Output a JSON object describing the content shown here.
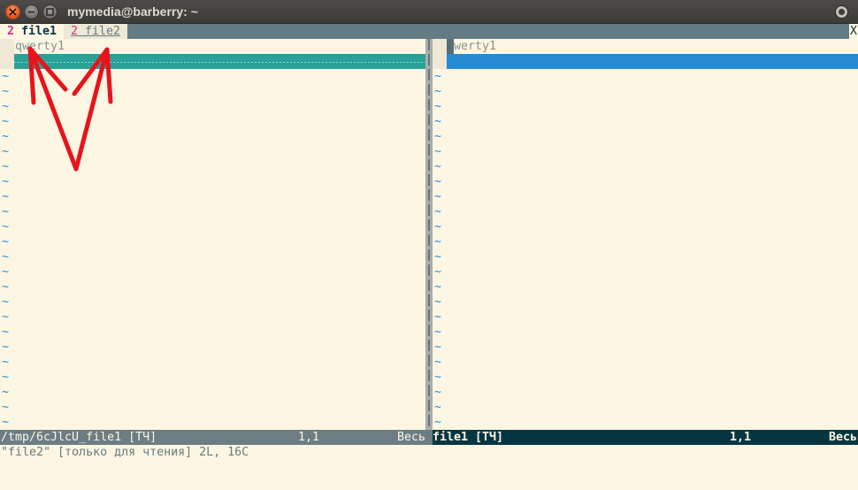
{
  "window": {
    "title": "mymedia@barberry: ~",
    "icons": {
      "close": "close-icon",
      "minimize": "minimize-icon",
      "maximize": "maximize-icon",
      "options": "window-options-icon"
    }
  },
  "tabline": {
    "tabs": [
      {
        "count": "2",
        "label": "file1",
        "active": true
      },
      {
        "count": "2",
        "label": "file2",
        "active": false
      }
    ],
    "close_label": "X"
  },
  "left_window": {
    "lines": [
      "qwerty1"
    ],
    "empty_line_marker": "~"
  },
  "right_window": {
    "lines": [
      "qwerty1"
    ],
    "empty_line_marker": "~"
  },
  "status": {
    "left": {
      "file": "/tmp/6cJlcU_file1 [ТЧ]",
      "position": "1,1",
      "scroll": "Весь"
    },
    "right": {
      "file": "file1 [ТЧ]",
      "position": "1,1",
      "scroll": "Весь"
    }
  },
  "cmdline": "\"file2\" [только для чтения] 2L, 16C",
  "colors": {
    "background": "#fdf6e3",
    "diff_filler": "#2aa198",
    "diff_change": "#268bd2",
    "tab_number": "#d33682",
    "active_status": "#073642",
    "annotation_arrows": "#e8131b"
  }
}
